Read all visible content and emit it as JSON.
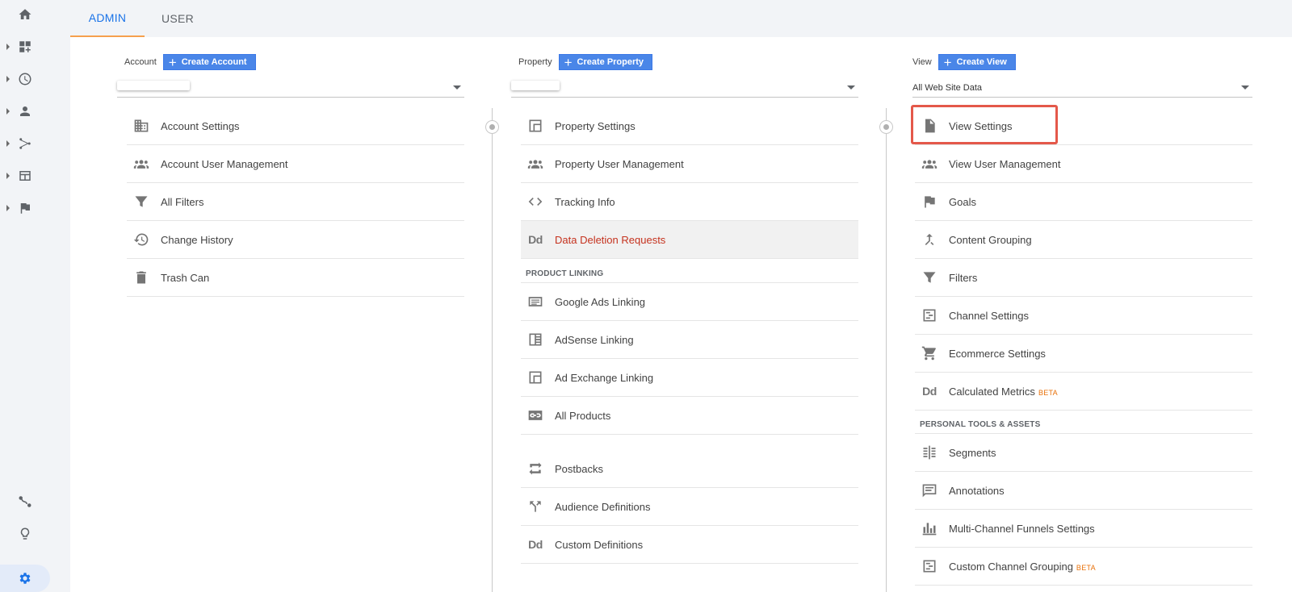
{
  "tabs": {
    "admin": "ADMIN",
    "user": "USER"
  },
  "nav_icons": [
    "home-icon",
    "customization-icon",
    "realtime-icon",
    "audience-icon",
    "acquisition-icon",
    "behavior-icon",
    "conversions-icon",
    "attribution-icon",
    "discover-icon",
    "admin-gear-icon"
  ],
  "account": {
    "label": "Account",
    "create_label": "Create Account",
    "items": [
      {
        "label": "Account Settings",
        "icon": "building-icon"
      },
      {
        "label": "Account User Management",
        "icon": "people-icon"
      },
      {
        "label": "All Filters",
        "icon": "filter-icon"
      },
      {
        "label": "Change History",
        "icon": "history-icon"
      },
      {
        "label": "Trash Can",
        "icon": "trash-icon"
      }
    ]
  },
  "property": {
    "label": "Property",
    "create_label": "Create Property",
    "items": [
      {
        "label": "Property Settings",
        "icon": "window-icon"
      },
      {
        "label": "Property User Management",
        "icon": "people-icon"
      },
      {
        "label": "Tracking Info",
        "icon": "code-icon"
      },
      {
        "label": "Data Deletion Requests",
        "icon": "dd-icon"
      }
    ],
    "section_product_linking": "PRODUCT LINKING",
    "linking_items": [
      {
        "label": "Google Ads Linking",
        "icon": "ads-icon"
      },
      {
        "label": "AdSense Linking",
        "icon": "adsense-icon"
      },
      {
        "label": "Ad Exchange Linking",
        "icon": "window-icon"
      },
      {
        "label": "All Products",
        "icon": "link-icon"
      },
      {
        "label": "Postbacks",
        "icon": "postback-icon"
      },
      {
        "label": "Audience Definitions",
        "icon": "fork-icon"
      },
      {
        "label": "Custom Definitions",
        "icon": "dd-icon"
      }
    ]
  },
  "view": {
    "label": "View",
    "create_label": "Create View",
    "selected": "All Web Site Data",
    "items": [
      {
        "label": "View Settings",
        "icon": "document-icon"
      },
      {
        "label": "View User Management",
        "icon": "people-icon"
      },
      {
        "label": "Goals",
        "icon": "flag-icon"
      },
      {
        "label": "Content Grouping",
        "icon": "merge-icon"
      },
      {
        "label": "Filters",
        "icon": "filter-icon"
      },
      {
        "label": "Channel Settings",
        "icon": "channel-icon"
      },
      {
        "label": "Ecommerce Settings",
        "icon": "cart-icon"
      },
      {
        "label": "Calculated Metrics",
        "icon": "dd-icon",
        "badge": "BETA"
      }
    ],
    "section_personal": "PERSONAL TOOLS & ASSETS",
    "personal_items": [
      {
        "label": "Segments",
        "icon": "segments-icon"
      },
      {
        "label": "Annotations",
        "icon": "comment-icon"
      },
      {
        "label": "Multi-Channel Funnels Settings",
        "icon": "bar-chart-icon"
      },
      {
        "label": "Custom Channel Grouping",
        "icon": "channel-icon",
        "badge": "BETA"
      }
    ]
  },
  "colors": {
    "accent": "#1a73e8",
    "button": "#4a86e8",
    "tab_underline": "#f6a04d",
    "highlight": "#e4584a",
    "red_link": "#c5321e"
  }
}
